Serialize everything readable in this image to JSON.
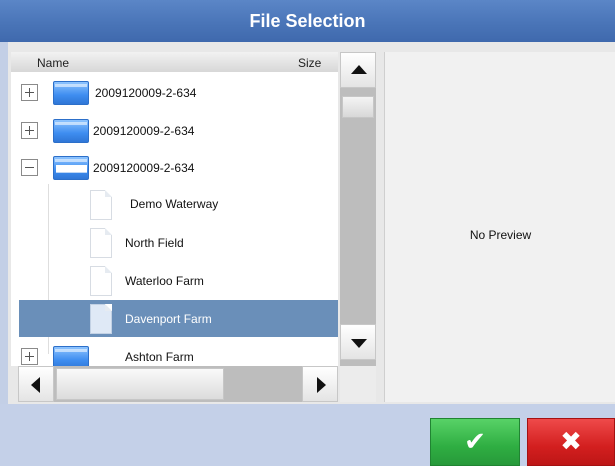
{
  "dialog": {
    "title": "File Selection"
  },
  "tree": {
    "columns": {
      "name": "Name",
      "size": "Size"
    },
    "rows": [
      {
        "label": "2009120009-2-634",
        "type": "folder",
        "expander": "+",
        "expanded": false,
        "selected": false
      },
      {
        "label": "2009120009-2-634",
        "type": "folder",
        "expander": "+",
        "expanded": false,
        "selected": false
      },
      {
        "label": "2009120009-2-634",
        "type": "folder",
        "expander": "−",
        "expanded": true,
        "selected": false
      },
      {
        "label": "Demo Waterway",
        "type": "file",
        "selected": false
      },
      {
        "label": "North Field",
        "type": "file",
        "selected": false
      },
      {
        "label": "Waterloo Farm",
        "type": "file",
        "selected": false
      },
      {
        "label": "Davenport Farm",
        "type": "file",
        "selected": true
      },
      {
        "label": "Ashton Farm",
        "type": "folder",
        "expander": "+",
        "expanded": false,
        "selected": false
      }
    ]
  },
  "preview": {
    "text": "No Preview"
  },
  "buttons": {
    "ok_glyph": "✔",
    "cancel_glyph": "✖"
  },
  "icons": {
    "folder": "folder-icon",
    "file": "document-icon",
    "ok": "checkmark-icon",
    "cancel": "x-icon"
  },
  "colors": {
    "titlebar": "#4a75b8",
    "selection": "#6a8fb9",
    "ok": "#2fae42",
    "cancel": "#d31f1f"
  }
}
